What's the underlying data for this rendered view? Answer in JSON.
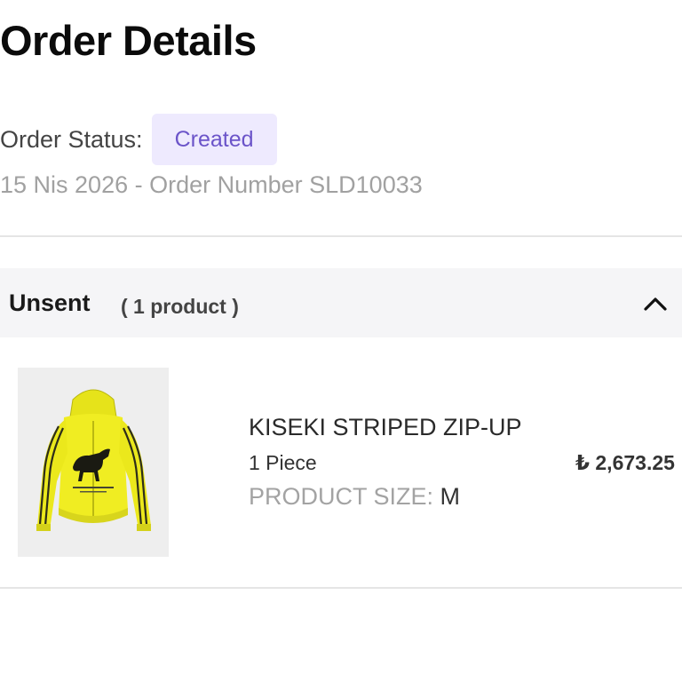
{
  "page": {
    "title": "Order Details"
  },
  "order": {
    "status_label": "Order Status:",
    "status_value": "Created",
    "meta": "15 Nis 2026 - Order Number SLD10033",
    "status_badge_color": "#6b54c9",
    "status_badge_bg": "#eeeafe"
  },
  "group": {
    "title": "Unsent",
    "count": "( 1 product )",
    "toggle_icon": "chevron-up-icon"
  },
  "product": {
    "image_icon": "hoodie-product-image",
    "name": "KISEKI STRIPED ZIP-UP",
    "quantity": "1 Piece",
    "price": "₺ 2,673.25",
    "size_label": "PRODUCT SIZE:",
    "size_value": "M"
  }
}
